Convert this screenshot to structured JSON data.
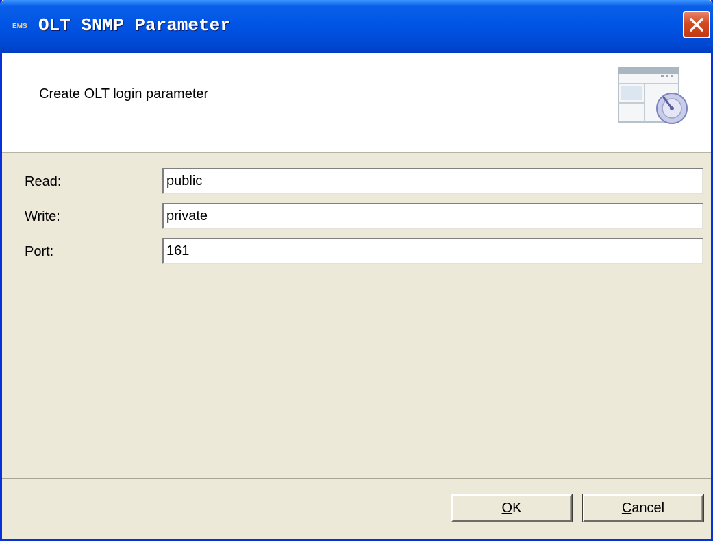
{
  "window": {
    "app_icon_text": "EMS",
    "title": "OLT SNMP Parameter"
  },
  "header": {
    "description": "Create OLT login parameter",
    "icon": "settings-window-gauge-icon"
  },
  "form": {
    "read": {
      "label": "Read:",
      "value": "public"
    },
    "write": {
      "label": "Write:",
      "value": "private"
    },
    "port": {
      "label": "Port:",
      "value": "161"
    }
  },
  "buttons": {
    "ok": {
      "mnemonic": "O",
      "rest": "K"
    },
    "cancel": {
      "mnemonic": "C",
      "rest": "ancel"
    }
  },
  "colors": {
    "titlebar": "#0055e5",
    "dialog_bg": "#ece9d8",
    "close_button": "#d4481f",
    "field_border": "#7f9db9"
  }
}
